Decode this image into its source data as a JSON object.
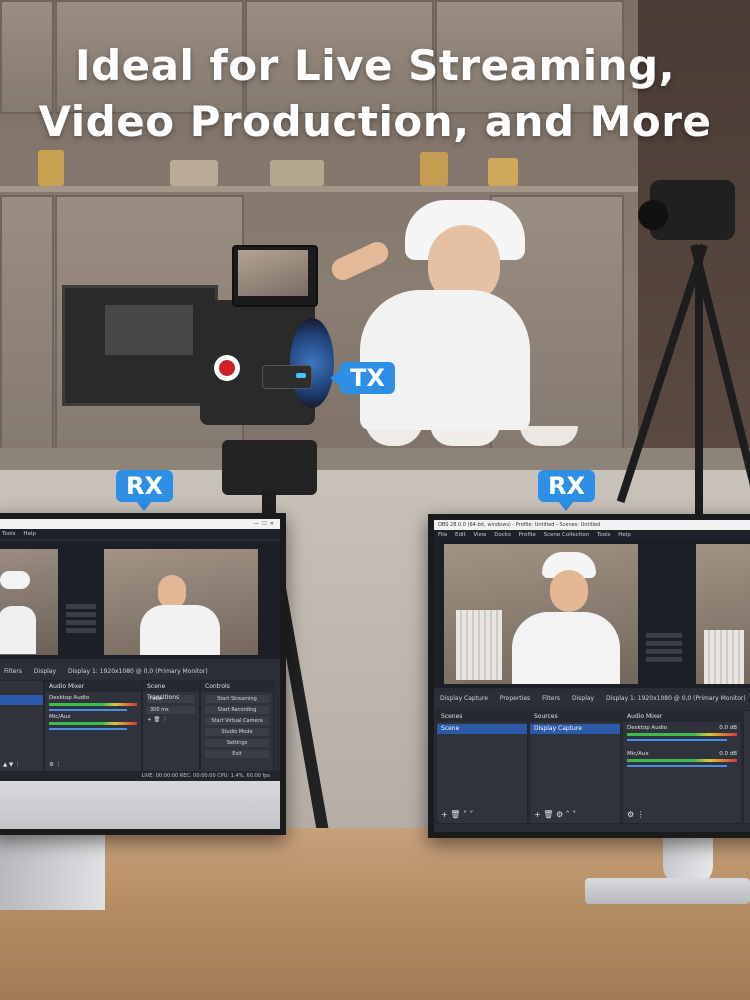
{
  "headline": {
    "line1": "Ideal for Live Streaming,",
    "line2": "Video Production, and More"
  },
  "badges": {
    "tx": "TX",
    "rx_left": "RX",
    "rx_right": "RX"
  },
  "colors": {
    "badge": "#2d8fe6",
    "obs_bg": "#2a2d36",
    "selected": "#2c5aa8"
  },
  "left_monitor": {
    "menu": [
      "Tools",
      "Help"
    ],
    "toolbar": [
      "Filters",
      "Display",
      "Display 1: 1920x1080 @ 0,0 (Primary Monitor)"
    ],
    "panels": {
      "audio": "Audio Mixer",
      "transitions": "Scene Transitions",
      "controls": "Controls"
    },
    "audio": [
      "Desktop Audio",
      "Mic/Aux"
    ],
    "transition_fade": "Fade",
    "transition_duration": "300 ms",
    "controls": [
      "Start Streaming",
      "Start Recording",
      "Start Virtual Camera",
      "Studio Mode",
      "Settings",
      "Exit"
    ],
    "status": "LIVE: 00:00:00   REC: 00:00:00   CPU: 1.4%, 60.00 fps"
  },
  "right_monitor": {
    "title": "OBS 28.0.0 (64-bit, windows) - Profile: Untitled - Scenes: Untitled",
    "menu": [
      "File",
      "Edit",
      "View",
      "Docks",
      "Profile",
      "Scene Collection",
      "Tools",
      "Help"
    ],
    "toolbar": [
      "Display Capture",
      "Properties",
      "Filters",
      "Display",
      "Display 1: 1920x1080 @ 0,0 (Primary Monitor)"
    ],
    "panels": {
      "scenes": "Scenes",
      "sources": "Sources",
      "audio": "Audio Mixer"
    },
    "scene_item": "Scene",
    "source_item": "Display Capture",
    "audio": [
      "Desktop Audio",
      "Mic/Aux"
    ],
    "audio_level": "0.0 dB"
  }
}
